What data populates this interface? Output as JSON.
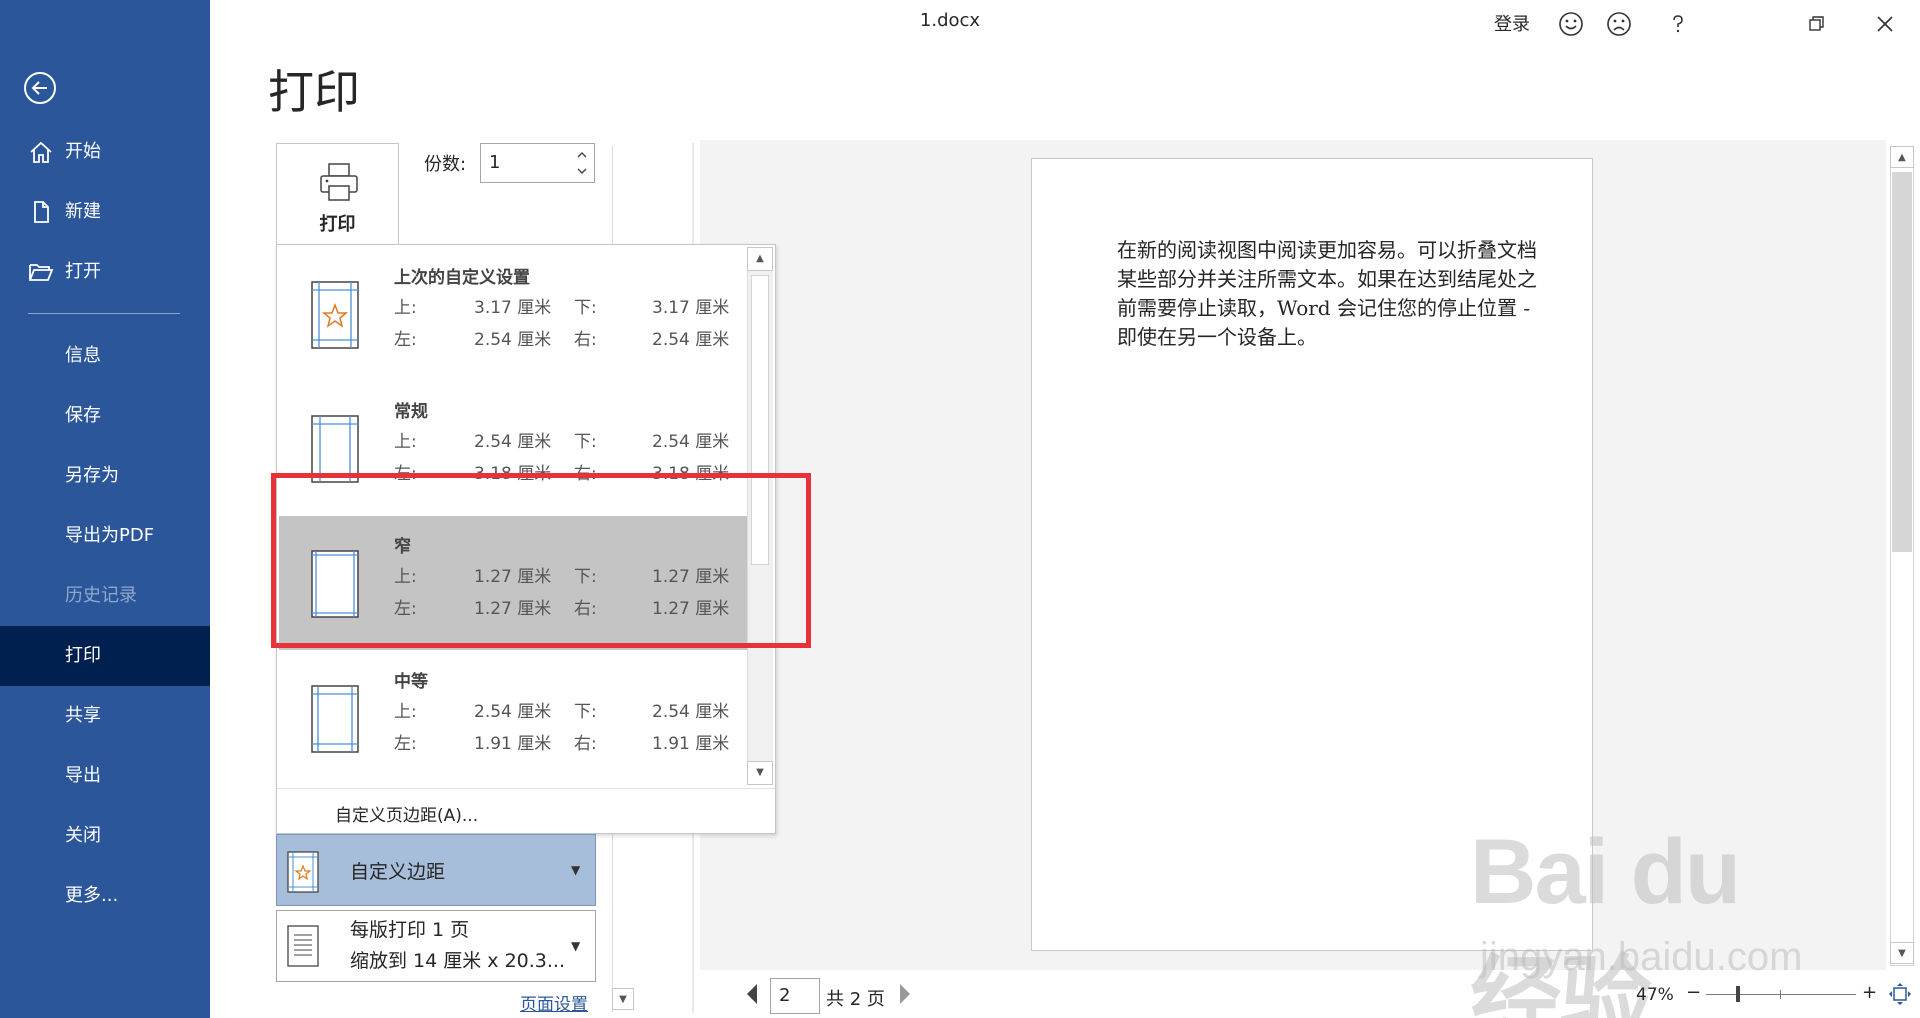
{
  "window": {
    "title": "1.docx",
    "login_label": "登录"
  },
  "sidebar": {
    "items": [
      {
        "label": "开始",
        "icon": "home-icon"
      },
      {
        "label": "新建",
        "icon": "new-document-icon"
      },
      {
        "label": "打开",
        "icon": "open-folder-icon"
      },
      {
        "label": "信息"
      },
      {
        "label": "保存"
      },
      {
        "label": "另存为"
      },
      {
        "label": "导出为PDF"
      },
      {
        "label": "历史记录",
        "disabled": true
      },
      {
        "label": "打印",
        "active": true
      },
      {
        "label": "共享"
      },
      {
        "label": "导出"
      },
      {
        "label": "关闭"
      },
      {
        "label": "更多..."
      }
    ]
  },
  "print": {
    "heading": "打印",
    "print_button_label": "打印",
    "copies_label": "份数:",
    "copies_value": "1"
  },
  "margins_dropdown": {
    "options": [
      {
        "name": "上次的自定义设置",
        "top_label": "上:",
        "top": "3.17 厘米",
        "bottom_label": "下:",
        "bottom": "3.17 厘米",
        "left_label": "左:",
        "left": "2.54 厘米",
        "right_label": "右:",
        "right": "2.54 厘米",
        "icon": "custom-margins-star-icon"
      },
      {
        "name": "常规",
        "top_label": "上:",
        "top": "2.54 厘米",
        "bottom_label": "下:",
        "bottom": "2.54 厘米",
        "left_label": "左:",
        "left": "3.18 厘米",
        "right_label": "右:",
        "right": "3.18 厘米",
        "icon": "normal-margins-icon"
      },
      {
        "name": "窄",
        "top_label": "上:",
        "top": "1.27 厘米",
        "bottom_label": "下:",
        "bottom": "1.27 厘米",
        "left_label": "左:",
        "left": "1.27 厘米",
        "right_label": "右:",
        "right": "1.27 厘米",
        "icon": "narrow-margins-icon",
        "selected": true
      },
      {
        "name": "中等",
        "top_label": "上:",
        "top": "2.54 厘米",
        "bottom_label": "下:",
        "bottom": "2.54 厘米",
        "left_label": "左:",
        "left": "1.91 厘米",
        "right_label": "右:",
        "right": "1.91 厘米",
        "icon": "moderate-margins-icon"
      }
    ],
    "custom_link": "自定义页边距(A)..."
  },
  "settings": {
    "margin_setting_label": "自定义边距",
    "pages_per_sheet": "每版打印 1 页",
    "scale_to": "缩放到 14 厘米 x 20.3...",
    "page_setup_link": "页面设置"
  },
  "preview": {
    "text": "在新的阅读视图中阅读更加容易。可以折叠文档某些部分并关注所需文本。如果在达到结尾处之前需要停止读取，Word 会记住您的停止位置 - 即使在另一个设备上。"
  },
  "bottom_nav": {
    "page_value": "2",
    "page_total": "共 2 页",
    "zoom_level": "47%",
    "zoom_minus": "−",
    "zoom_plus": "+"
  },
  "watermark": {
    "big": "Bai du 经验",
    "small": "jingyan.baidu.com"
  },
  "colors": {
    "sidebar": "#2b579a",
    "sidebar_active": "#002050",
    "highlight": "#e8323a",
    "selected_option": "#c4c4c4",
    "margin_setting": "#a7bedb"
  }
}
